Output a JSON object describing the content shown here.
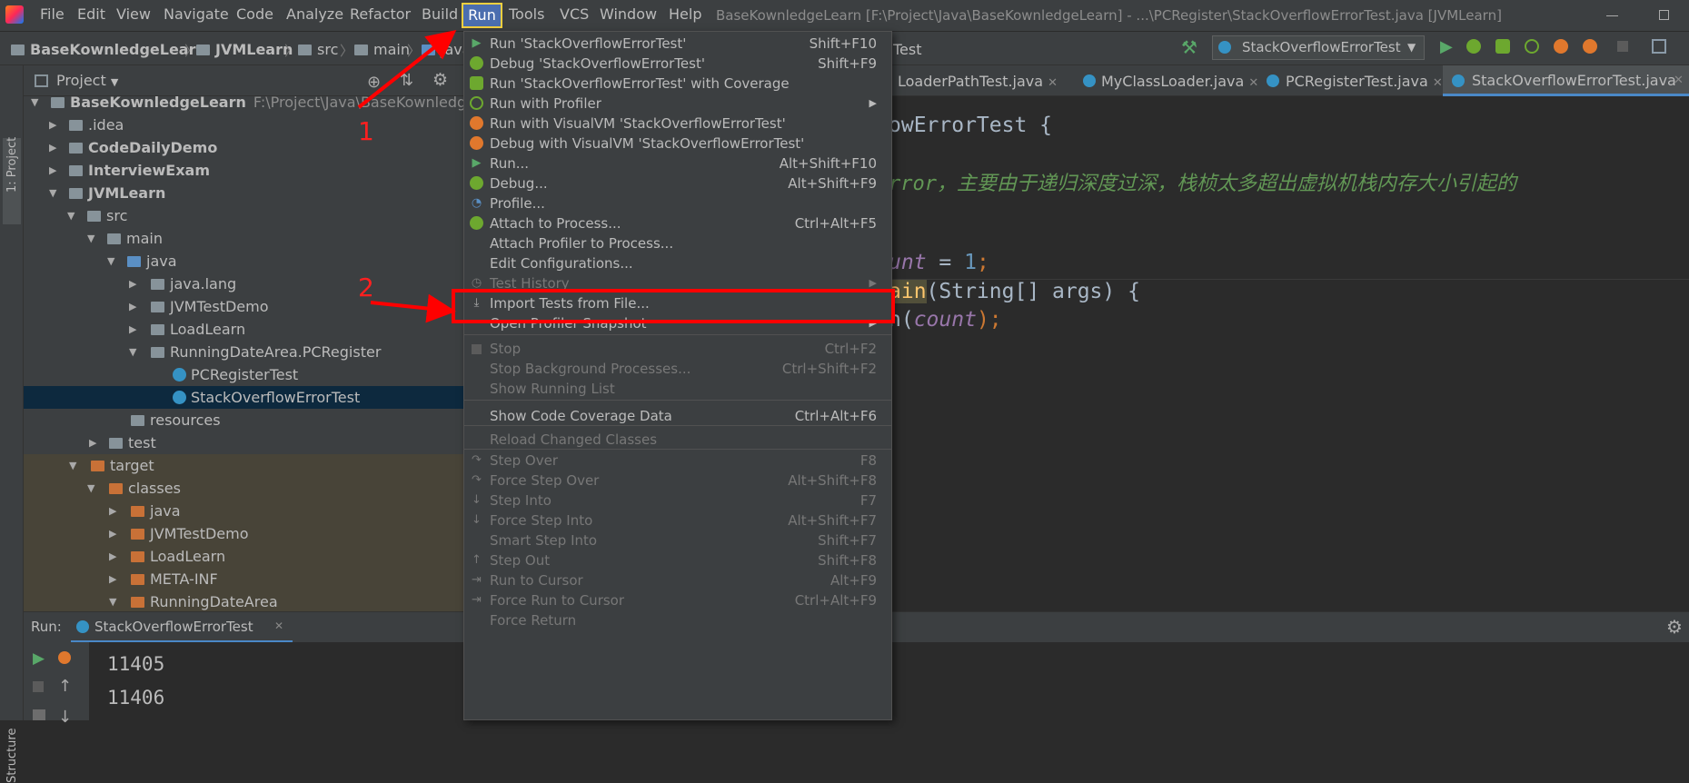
{
  "menubar": {
    "items": [
      "File",
      "Edit",
      "View",
      "Navigate",
      "Code",
      "Analyze",
      "Refactor",
      "Build",
      "Run",
      "Tools",
      "VCS",
      "Window",
      "Help"
    ],
    "title": "BaseKownledgeLearn [F:\\Project\\Java\\BaseKownledgeLearn] - ...\\PCRegister\\StackOverflowErrorTest.java [JVMLearn]"
  },
  "navbar": {
    "crumbs": [
      "BaseKownledgeLearn",
      "JVMLearn",
      "src",
      "main",
      "java"
    ],
    "crumb_tail": "Test",
    "run_config": "StackOverflowErrorTest"
  },
  "sidebar": {
    "project_tab": "1: Project",
    "structure_tab": "Structure"
  },
  "project_panel": {
    "title": "Project",
    "tree": [
      {
        "label": "BaseKownledgeLearn",
        "path": "F:\\Project\\Java\\BaseKownledgeLearn"
      },
      {
        "label": ".idea"
      },
      {
        "label": "CodeDailyDemo"
      },
      {
        "label": "InterviewExam"
      },
      {
        "label": "JVMLearn"
      },
      {
        "label": "src"
      },
      {
        "label": "main"
      },
      {
        "label": "java"
      },
      {
        "label": "java.lang"
      },
      {
        "label": "JVMTestDemo"
      },
      {
        "label": "LoadLearn"
      },
      {
        "label": "RunningDateArea.PCRegister"
      },
      {
        "label": "PCRegisterTest"
      },
      {
        "label": "StackOverflowErrorTest"
      },
      {
        "label": "resources"
      },
      {
        "label": "test"
      },
      {
        "label": "target"
      },
      {
        "label": "classes"
      },
      {
        "label": "java"
      },
      {
        "label": "JVMTestDemo"
      },
      {
        "label": "LoadLearn"
      },
      {
        "label": "META-INF"
      },
      {
        "label": "RunningDateArea"
      }
    ]
  },
  "editor": {
    "tabs": [
      "LoaderPathTest.java",
      "MyClassLoader.java",
      "PCRegisterTest.java",
      "StackOverflowErrorTest.java"
    ],
    "lines": {
      "l1": "owErrorTest {",
      "l2": "rror，主要由于递归深度过深，栈桢太多超出虚拟机栈内存大小引起的",
      "l3a": "unt",
      "l3b": " = ",
      "l3c": "1",
      "l3d": ";",
      "l4a": "ain",
      "l4b": "(String[] args) {",
      "l5a": "n(",
      "l5b": "count",
      "l5c": ");"
    }
  },
  "run_panel": {
    "label": "Run:",
    "tab": "StackOverflowErrorTest",
    "output": [
      "11405",
      "11406"
    ]
  },
  "run_menu": {
    "items": [
      {
        "label": "Run 'StackOverflowErrorTest'",
        "shortcut": "Shift+F10",
        "icon": "play-icon"
      },
      {
        "label": "Debug 'StackOverflowErrorTest'",
        "shortcut": "Shift+F9",
        "icon": "bug-icon"
      },
      {
        "label": "Run 'StackOverflowErrorTest' with Coverage",
        "shortcut": "",
        "icon": "coverage-icon"
      },
      {
        "label": "Run with Profiler",
        "shortcut": "",
        "icon": "profiler-icon",
        "submenu": true
      },
      {
        "label": "Run with VisualVM 'StackOverflowErrorTest'",
        "shortcut": "",
        "icon": "visualvm-icon"
      },
      {
        "label": "Debug with VisualVM 'StackOverflowErrorTest'",
        "shortcut": "",
        "icon": "visualvm-debug-icon"
      },
      {
        "label": "Run...",
        "shortcut": "Alt+Shift+F10",
        "icon": "play-icon"
      },
      {
        "label": "Debug...",
        "shortcut": "Alt+Shift+F9",
        "icon": "bug-icon"
      },
      {
        "label": "Profile...",
        "shortcut": "",
        "icon": "gauge-icon"
      },
      {
        "label": "Attach to Process...",
        "shortcut": "Ctrl+Alt+F5",
        "icon": "attach-icon"
      },
      {
        "label": "Attach Profiler to Process...",
        "shortcut": "",
        "icon": ""
      },
      {
        "label": "Edit Configurations...",
        "shortcut": "",
        "icon": ""
      },
      {
        "label": "Test History",
        "shortcut": "",
        "icon": "clock-icon",
        "submenu": true,
        "disabled": true
      },
      {
        "label": "Import Tests from File...",
        "shortcut": "",
        "icon": "import-icon"
      },
      {
        "label": "Open Profiler Snapshot",
        "shortcut": "",
        "icon": "",
        "submenu": true
      },
      {
        "label": "Stop",
        "shortcut": "Ctrl+F2",
        "icon": "stop-icon",
        "disabled": true
      },
      {
        "label": "Stop Background Processes...",
        "shortcut": "Ctrl+Shift+F2",
        "icon": "",
        "disabled": true
      },
      {
        "label": "Show Running List",
        "shortcut": "",
        "icon": "",
        "disabled": true
      },
      {
        "label": "Show Code Coverage Data",
        "shortcut": "Ctrl+Alt+F6",
        "icon": ""
      },
      {
        "label": "Reload Changed Classes",
        "shortcut": "",
        "icon": "",
        "disabled": true
      },
      {
        "label": "Step Over",
        "shortcut": "F8",
        "icon": "step-over-icon",
        "disabled": true
      },
      {
        "label": "Force Step Over",
        "shortcut": "Alt+Shift+F8",
        "icon": "force-step-over-icon",
        "disabled": true
      },
      {
        "label": "Step Into",
        "shortcut": "F7",
        "icon": "step-into-icon",
        "disabled": true
      },
      {
        "label": "Force Step Into",
        "shortcut": "Alt+Shift+F7",
        "icon": "force-step-into-icon",
        "disabled": true
      },
      {
        "label": "Smart Step Into",
        "shortcut": "Shift+F7",
        "icon": "",
        "disabled": true
      },
      {
        "label": "Step Out",
        "shortcut": "Shift+F8",
        "icon": "step-out-icon",
        "disabled": true
      },
      {
        "label": "Run to Cursor",
        "shortcut": "Alt+F9",
        "icon": "run-to-cursor-icon",
        "disabled": true
      },
      {
        "label": "Force Run to Cursor",
        "shortcut": "Ctrl+Alt+F9",
        "icon": "force-run-to-cursor-icon",
        "disabled": true
      },
      {
        "label": "Force Return",
        "shortcut": "",
        "icon": "",
        "disabled": true
      }
    ]
  },
  "annotations": {
    "step1": "1",
    "step2": "2"
  },
  "colors": {
    "accent": "#4b6eaf",
    "annotation": "#ff0000",
    "selection": "#0d293e",
    "play": "#59a869",
    "bug": "#6da82f"
  }
}
